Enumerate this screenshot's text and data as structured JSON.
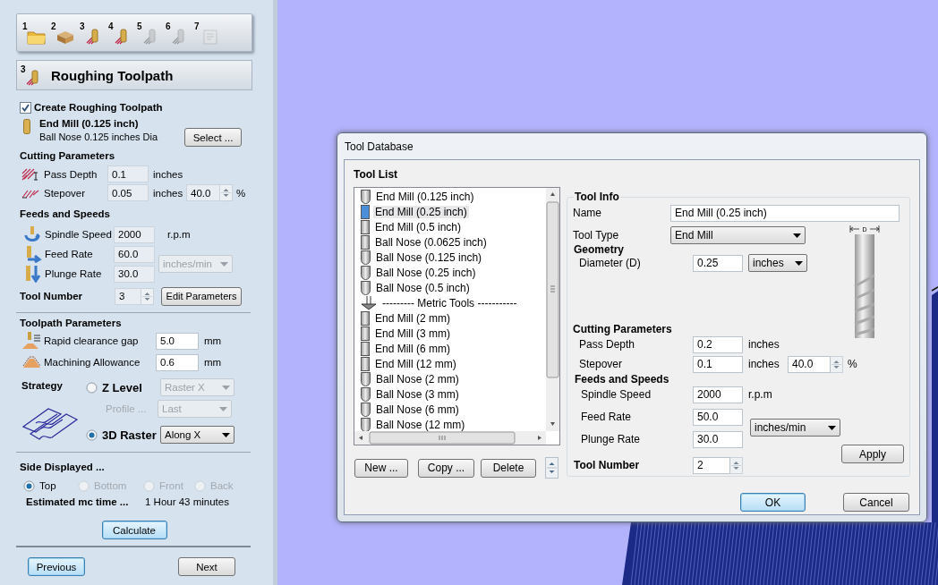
{
  "left_panel": {
    "steps": [
      {
        "number": "1",
        "enabled": true
      },
      {
        "number": "2",
        "enabled": true
      },
      {
        "number": "3",
        "enabled": true
      },
      {
        "number": "4",
        "enabled": true
      },
      {
        "number": "5",
        "enabled": false
      },
      {
        "number": "6",
        "enabled": false
      },
      {
        "number": "7",
        "enabled": false
      }
    ],
    "header": {
      "number": "3",
      "title": "Roughing Toolpath"
    },
    "create_toolpath": {
      "label": "Create Roughing Toolpath",
      "checked": true
    },
    "tool": {
      "name": "End Mill (0.125 inch)",
      "description": "Ball Nose 0.125 inches Dia",
      "select_button": "Select ..."
    },
    "cutting_parameters": {
      "title": "Cutting Parameters",
      "pass_depth": {
        "label": "Pass Depth",
        "value": "0.1",
        "disabled": true,
        "unit": "inches"
      },
      "stepover": {
        "label": "Stepover",
        "value": "0.05",
        "disabled": true,
        "unit": "inches",
        "percent": "40.0",
        "percent_unit": "%"
      }
    },
    "feeds_and_speeds": {
      "title": "Feeds and Speeds",
      "spindle_speed": {
        "label": "Spindle Speed",
        "value": "2000",
        "disabled": true,
        "unit": "r.p.m"
      },
      "feed_rate": {
        "label": "Feed Rate",
        "value": "60.0",
        "disabled": true
      },
      "plunge_rate": {
        "label": "Plunge Rate",
        "value": "30.0",
        "disabled": true
      },
      "rate_units": {
        "value": "inches/min",
        "disabled": true
      }
    },
    "tool_number": {
      "label": "Tool Number",
      "value": "3",
      "disabled": true,
      "edit_button": "Edit Parameters"
    },
    "toolpath_parameters": {
      "title": "Toolpath Parameters",
      "rapid_clearance_gap": {
        "label": "Rapid clearance gap",
        "value": "5.0",
        "disabled": false,
        "unit": "mm"
      },
      "machining_allowance": {
        "label": "Machining Allowance",
        "value": "0.6",
        "disabled": false,
        "unit": "mm"
      }
    },
    "strategy": {
      "title": "Strategy",
      "z_level": {
        "label": "Z Level",
        "selected": false,
        "dropdown": {
          "value": "Raster X",
          "disabled": true
        }
      },
      "profile": {
        "label": "Profile ...",
        "disabled": true,
        "dropdown": {
          "value": "Last",
          "disabled": true
        }
      },
      "raster_3d": {
        "label": "3D Raster",
        "selected": true,
        "dropdown": {
          "value": "Along X",
          "disabled": false
        }
      }
    },
    "side_displayed": {
      "title": "Side Displayed ...",
      "options": [
        {
          "label": "Top",
          "selected": true,
          "disabled": false
        },
        {
          "label": "Bottom",
          "selected": false,
          "disabled": true
        },
        {
          "label": "Front",
          "selected": false,
          "disabled": true
        },
        {
          "label": "Back",
          "selected": false,
          "disabled": true
        }
      ]
    },
    "estimated_time": {
      "label": "Estimated mc time ...",
      "value": "1 Hour 43 minutes"
    },
    "calculate_button": {
      "label": "Calculate",
      "highlighted": true
    },
    "previous_button": {
      "label": "Previous",
      "highlighted": true
    },
    "next_button": {
      "label": "Next",
      "highlighted": false
    }
  },
  "dialog": {
    "title": "Tool Database",
    "tool_list": {
      "title": "Tool List",
      "items": [
        {
          "label": "End Mill (0.125 inch)",
          "kind": "round",
          "selected": false
        },
        {
          "label": "End Mill (0.25 inch)",
          "kind": "flat",
          "selected": true
        },
        {
          "label": "End Mill (0.5 inch)",
          "kind": "flat",
          "selected": false
        },
        {
          "label": "Ball Nose (0.0625 inch)",
          "kind": "flat",
          "selected": false
        },
        {
          "label": "Ball Nose (0.125 inch)",
          "kind": "round",
          "selected": false
        },
        {
          "label": "Ball Nose (0.25 inch)",
          "kind": "round",
          "selected": false
        },
        {
          "label": "Ball Nose (0.5 inch)",
          "kind": "round",
          "selected": false
        },
        {
          "label": "--------- Metric Tools -----------",
          "kind": "group",
          "selected": false
        },
        {
          "label": "End Mill (2 mm)",
          "kind": "flat",
          "selected": false
        },
        {
          "label": "End Mill (3 mm)",
          "kind": "flat",
          "selected": false
        },
        {
          "label": "End Mill (6 mm)",
          "kind": "flat",
          "selected": false
        },
        {
          "label": "End Mill (12 mm)",
          "kind": "flat",
          "selected": false
        },
        {
          "label": "Ball Nose (2 mm)",
          "kind": "round",
          "selected": false
        },
        {
          "label": "Ball Nose (3 mm)",
          "kind": "round",
          "selected": false
        },
        {
          "label": "Ball Nose (6 mm)",
          "kind": "round",
          "selected": false
        },
        {
          "label": "Ball Nose (12 mm)",
          "kind": "round",
          "selected": false
        }
      ]
    },
    "list_buttons": [
      "New ...",
      "Copy ...",
      "Delete"
    ],
    "tool_info": {
      "title": "Tool Info",
      "name": {
        "label": "Name",
        "value": "End Mill (0.25 inch)"
      },
      "tool_type": {
        "label": "Tool Type",
        "value": "End Mill"
      },
      "geometry_title": "Geometry",
      "diameter": {
        "label": "Diameter (D)",
        "value": "0.25",
        "unit": "inches"
      },
      "dimension_label": "D",
      "cutting_title": "Cutting Parameters",
      "pass_depth": {
        "label": "Pass Depth",
        "value": "0.2",
        "unit": "inches"
      },
      "stepover": {
        "label": "Stepover",
        "value": "0.1",
        "unit": "inches",
        "percent": "40.0",
        "percent_unit": "%"
      },
      "feeds_title": "Feeds and Speeds",
      "spindle_speed": {
        "label": "Spindle Speed",
        "value": "2000",
        "unit": "r.p.m"
      },
      "feed_rate": {
        "label": "Feed Rate",
        "value": "50.0"
      },
      "plunge_rate": {
        "label": "Plunge Rate",
        "value": "30.0"
      },
      "rate_units": "inches/min",
      "apply_button": "Apply",
      "tool_number": {
        "label": "Tool Number",
        "value": "2"
      }
    },
    "ok_button": {
      "label": "OK",
      "highlighted": true
    },
    "cancel_button": {
      "label": "Cancel",
      "highlighted": false
    }
  }
}
